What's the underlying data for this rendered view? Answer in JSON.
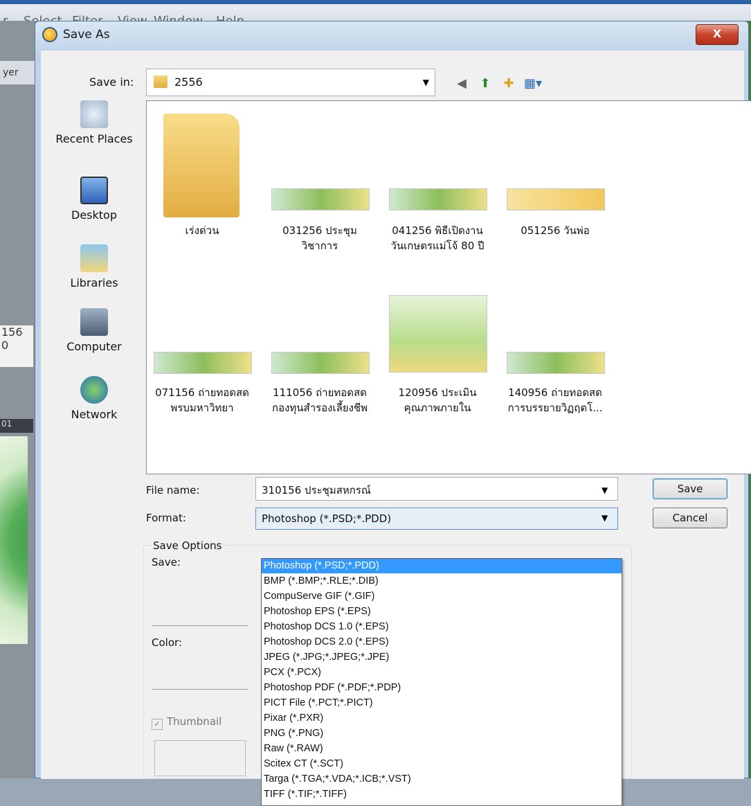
{
  "app_menu": [
    "Select",
    "Filter",
    "View",
    "Window",
    "Help"
  ],
  "background": {
    "panel_tab": "yer",
    "ruler_top": "156",
    "ruler_bottom": "0",
    "tab_label": "01"
  },
  "dialog": {
    "title": "Save As",
    "close_label": "X",
    "save_in_label": "Save in:",
    "save_in_value": "2556",
    "places": [
      {
        "label": "Recent Places",
        "icon": "recent-places-icon"
      },
      {
        "label": "Desktop",
        "icon": "desktop-icon"
      },
      {
        "label": "Libraries",
        "icon": "libraries-icon"
      },
      {
        "label": "Computer",
        "icon": "computer-icon"
      },
      {
        "label": "Network",
        "icon": "network-icon"
      }
    ],
    "files": [
      {
        "line1": "เร่งด่วน",
        "line2": ""
      },
      {
        "line1": "031256 ประชุม",
        "line2": "วิชาการ"
      },
      {
        "line1": "041256 พิธีเปิดงาน",
        "line2": "วันเกษตรแม่โจ้ 80 ปี"
      },
      {
        "line1": "051256 วันพ่อ",
        "line2": ""
      },
      {
        "line1": "071156 ถ่ายทอดสด",
        "line2": "พรบมหาวิทยา"
      },
      {
        "line1": "111056 ถ่ายทอดสด",
        "line2": "กองทุนสำรองเลี้ยงชีพ"
      },
      {
        "line1": "120956 ประเมิน",
        "line2": "คุณภาพภายใน"
      },
      {
        "line1": "140956 ถ่ายทอดสด",
        "line2": "การบรรยายวิฏฤตโ..."
      }
    ],
    "file_name_label": "File name:",
    "file_name_value": "310156 ประชุมสหกรณ์",
    "format_label": "Format:",
    "format_value": "Photoshop (*.PSD;*.PDD)",
    "save_button": "Save",
    "cancel_button": "Cancel",
    "save_options_label": "Save Options",
    "save_label": "Save:",
    "color_label": "Color:",
    "thumbnail_label": "Thumbnail",
    "format_options": [
      "Photoshop (*.PSD;*.PDD)",
      "BMP (*.BMP;*.RLE;*.DIB)",
      "CompuServe GIF (*.GIF)",
      "Photoshop EPS (*.EPS)",
      "Photoshop DCS 1.0 (*.EPS)",
      "Photoshop DCS 2.0 (*.EPS)",
      "JPEG (*.JPG;*.JPEG;*.JPE)",
      "PCX (*.PCX)",
      "Photoshop PDF (*.PDF;*.PDP)",
      "PICT File (*.PCT;*.PICT)",
      "Pixar (*.PXR)",
      "PNG (*.PNG)",
      "Raw (*.RAW)",
      "Scitex CT (*.SCT)",
      "Targa (*.TGA;*.VDA;*.ICB;*.VST)",
      "TIFF (*.TIF;*.TIFF)"
    ],
    "selected_format_index": 0
  },
  "colors": {
    "selection": "#3399ff",
    "close_button": "#c7432a"
  }
}
